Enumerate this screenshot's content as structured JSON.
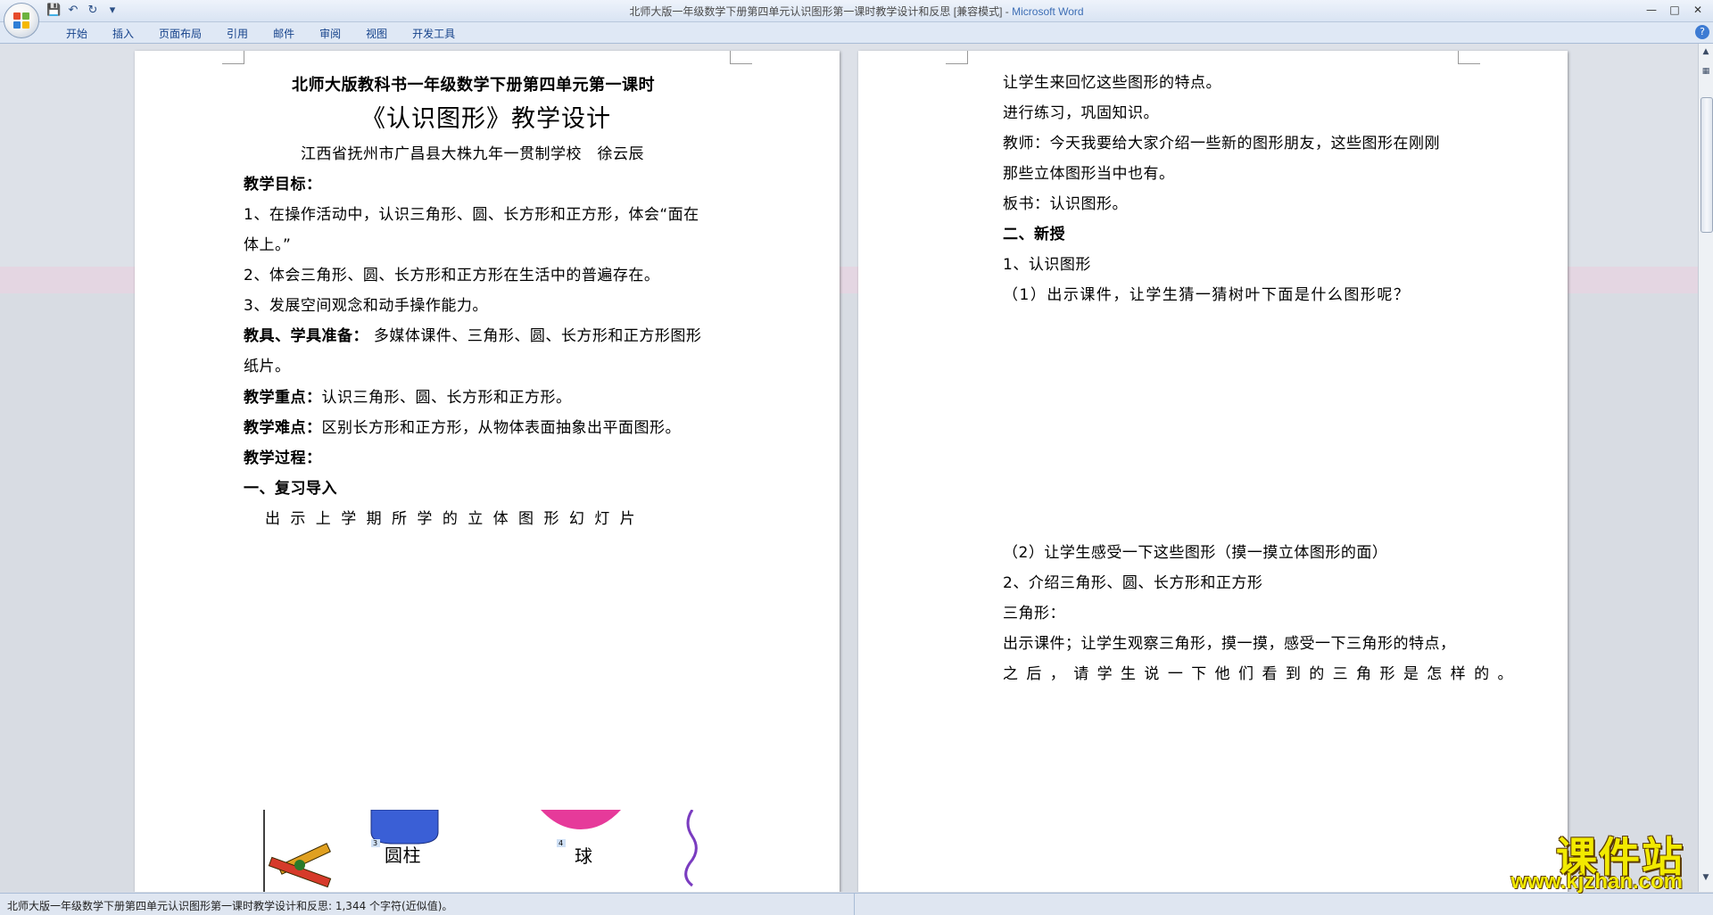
{
  "window": {
    "title": "北师大版一年级数学下册第四单元认识图形第一课时教学设计和反思 [兼容模式]",
    "app_name": "Microsoft Word"
  },
  "ribbon": {
    "tabs": [
      "开始",
      "插入",
      "页面布局",
      "引用",
      "邮件",
      "审阅",
      "视图",
      "开发工具"
    ]
  },
  "left_page": {
    "header_line": "北师大版教科书一年级数学下册第四单元第一课时",
    "main_title": "《认识图形》教学设计",
    "author": "江西省抚州市广昌县大株九年一贯制学校　徐云辰",
    "goals_heading": "教学目标：",
    "goal1_a": "1、在操作活动中，认识三角形、圆、长方形和正方形，体会“面在",
    "goal1_b": "体上。”",
    "goal2": "2、体会三角形、圆、长方形和正方形在生活中的普遍存在。",
    "goal3": "3、发展空间观念和动手操作能力。",
    "tools_label": "教具、学具准备：",
    "tools_text_a": " 多媒体课件、三角形、圆、长方形和正方形图形",
    "tools_text_b": "纸片。",
    "focus_label": "教学重点：",
    "focus_text": "认识三角形、圆、长方形和正方形。",
    "difficulty_label": "教学难点：",
    "difficulty_text": "区别长方形和正方形，从物体表面抽象出平面图形。",
    "process_label": "教学过程：",
    "section1": "一、复习导入",
    "show_slides": "出 示 上 学 期 所 学 的 立 体 图 形 幻 灯 片",
    "figure_cylinder": "圆柱",
    "figure_sphere": "球",
    "figure_num_3": "3",
    "figure_num_4": "4"
  },
  "right_page": {
    "l1": "让学生来回忆这些图形的特点。",
    "l2": "进行练习，巩固知识。",
    "l3": "教师：今天我要给大家介绍一些新的图形朋友，这些图形在刚刚",
    "l4": "那些立体图形当中也有。",
    "l5": "板书：认识图形。",
    "l6": "二、新授",
    "l7": "1、认识图形",
    "l8": "（1）出示课件，让学生猜一猜树叶下面是什么图形呢？",
    "l9": "（2）让学生感受一下这些图形（摸一摸立体图形的面）",
    "l10": "2、介绍三角形、圆、长方形和正方形",
    "l11": "三角形：",
    "l12": "出示课件；让学生观察三角形，摸一摸，感受一下三角形的特点，",
    "l13": "之 后 ， 请 学 生 说 一 下 他 们 看 到 的 三 角 形 是 怎 样 的 。"
  },
  "status_bar": {
    "text": "北师大版一年级数学下册第四单元认识图形第一课时教学设计和反思: 1,344 个字符(近似值)。"
  },
  "watermark": {
    "brand": "课件站",
    "url": "www.kjzhan.com"
  },
  "colors": {
    "ribbon_bg": "#dfe8f5",
    "tab_text": "#15428b",
    "workspace_bg": "#d8dce3",
    "watermark": "#f2ea00"
  }
}
